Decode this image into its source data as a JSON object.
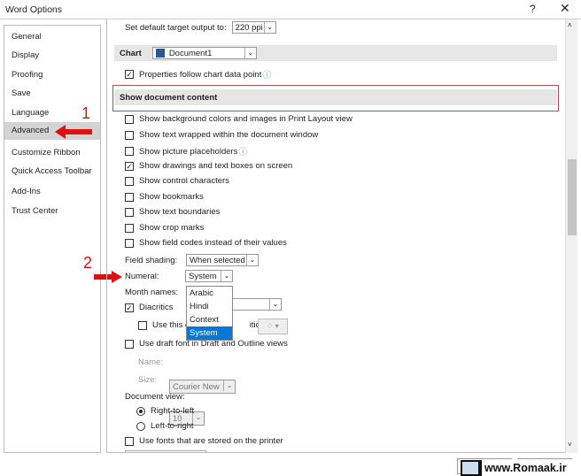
{
  "window": {
    "title": "Word Options",
    "help": "?",
    "close": "✕"
  },
  "sidebar": {
    "items": [
      {
        "label": "General"
      },
      {
        "label": "Display"
      },
      {
        "label": "Proofing"
      },
      {
        "label": "Save"
      },
      {
        "label": "Language"
      },
      {
        "label": "Advanced",
        "selected": true
      },
      {
        "label": "Customize Ribbon"
      },
      {
        "label": "Quick Access Toolbar"
      },
      {
        "label": "Add-Ins"
      },
      {
        "label": "Trust Center"
      }
    ]
  },
  "annotations": {
    "step1": "1",
    "step2": "2",
    "color": "#dd1111"
  },
  "content": {
    "default_output_label": "Set default target output to:",
    "default_output_value": "220 ppi",
    "chart_label": "Chart",
    "chart_doc": "Document1",
    "properties_follow": {
      "label": "Properties follow chart data point",
      "checked": true
    },
    "section_title": "Show document content",
    "options": [
      {
        "label": "Show background colors and images in Print Layout view",
        "checked": false
      },
      {
        "label": "Show text wrapped within the document window",
        "checked": false
      },
      {
        "label": "Show picture placeholders",
        "checked": false,
        "info": true
      },
      {
        "label": "Show drawings and text boxes on screen",
        "checked": true
      },
      {
        "label": "Show control characters",
        "checked": false
      },
      {
        "label": "Show bookmarks",
        "checked": false
      },
      {
        "label": "Show text boundaries",
        "checked": false
      },
      {
        "label": "Show crop marks",
        "checked": false
      },
      {
        "label": "Show field codes instead of their values",
        "checked": false
      }
    ],
    "field_shading_label": "Field shading:",
    "field_shading_value": "When selected",
    "numeral_label": "Numeral:",
    "numeral_value": "System",
    "numeral_options": [
      "Arabic",
      "Hindi",
      "Context",
      "System"
    ],
    "month_names_label": "Month names:",
    "diacritics": {
      "label": "Diacritics",
      "checked": true
    },
    "use_this_color": {
      "label_start": "Use this c",
      "label_end": "itics",
      "checked": false
    },
    "draft_font": {
      "label": "Use draft font in Draft and Outline views",
      "checked": false
    },
    "name_label": "Name:",
    "name_value": "Courier New",
    "size_label": "Size:",
    "size_value": "10",
    "doc_view_label": "Document view:",
    "rtl": {
      "label": "Right-to-left",
      "selected": true
    },
    "ltr": {
      "label": "Left-to-right",
      "selected": false
    },
    "printer_fonts": {
      "label": "Use fonts that are stored on the printer",
      "checked": false
    }
  },
  "watermark": "www.Romaak.ir"
}
